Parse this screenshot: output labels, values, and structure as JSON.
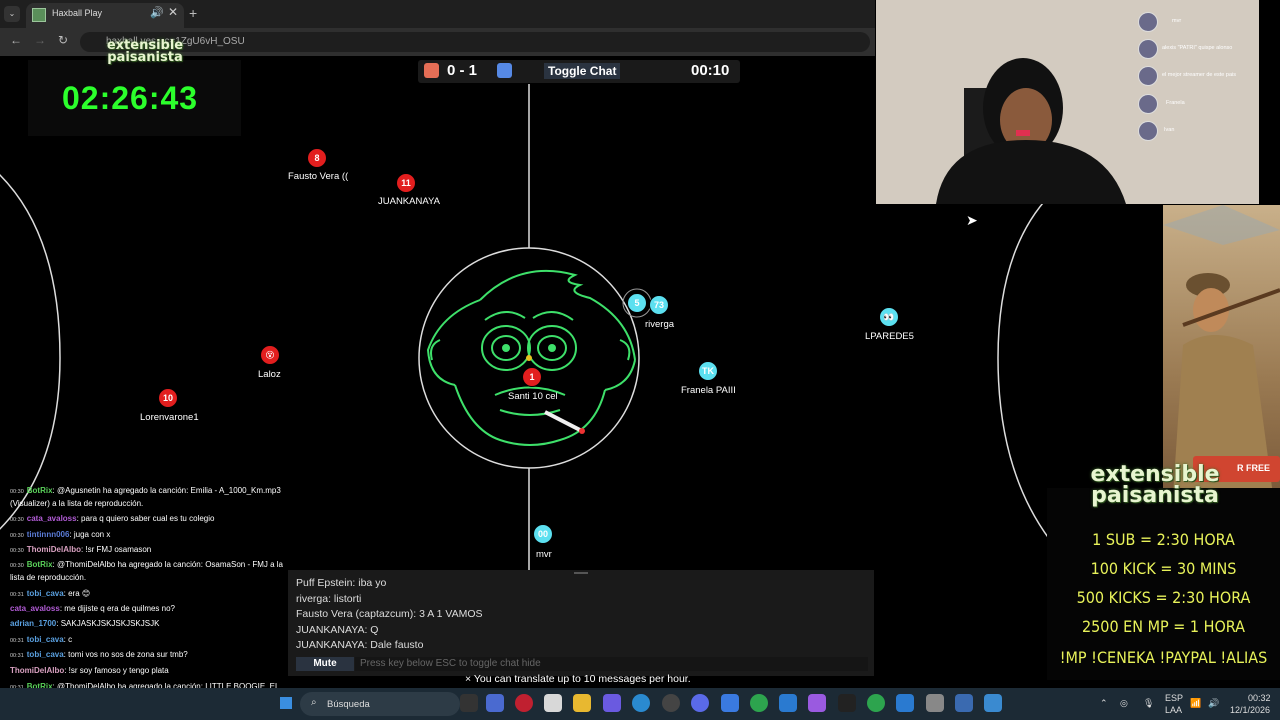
{
  "browser": {
    "tab_title": "Haxball Play",
    "url": "haxball.yes...c=1ZgU6vH_OSU",
    "new_tab": "+",
    "close": "✕",
    "speaker": "🔊",
    "menu": "⌄"
  },
  "stream_overlay": {
    "logo_line1": "extensible",
    "logo_line2": "paisanista",
    "timer": "02:26:43"
  },
  "game": {
    "score": "0 - 1",
    "toggle_chat": "Toggle Chat",
    "time": "00:10",
    "players": [
      {
        "team": "red",
        "number": "8",
        "name": "Fausto Vera (("
      },
      {
        "team": "red",
        "number": "11",
        "name": "JUANKANAYA"
      },
      {
        "team": "red",
        "number": "😵",
        "name": "Laloz"
      },
      {
        "team": "red",
        "number": "10",
        "name": "Lorenvarone1"
      },
      {
        "team": "red",
        "number": "1",
        "name": "Santi 10 cel"
      },
      {
        "team": "blue",
        "number": "5",
        "name": ""
      },
      {
        "team": "blue",
        "number": "73",
        "name": "riverga"
      },
      {
        "team": "blue",
        "number": "TK",
        "name": "Franela PAIII"
      },
      {
        "team": "blue",
        "number": "👀",
        "name": "LPAREDE5"
      },
      {
        "team": "blue",
        "number": "00",
        "name": "mvr"
      }
    ]
  },
  "webcam": {
    "viewers": [
      "mvr",
      "alexis \"PATRI\" quispe alonso",
      "el mejor streamer de este pais",
      "Franela",
      "Ivan"
    ]
  },
  "side_panel": {
    "rfree": "R FREE",
    "logo_line1": "extensible",
    "logo_line2": "paisanista",
    "lines": [
      "1 SUB = 2:30 HORA",
      "100 KICK = 30 MINS",
      "500 KICKS = 2:30 HORA",
      "2500 EN MP = 1 HORA",
      "!MP !CENEKA !PAYPAL !ALIAS"
    ]
  },
  "twitch_chat": [
    {
      "time": "00:30",
      "user": "BotRix",
      "color": "#5ad15a",
      "text": ": @Agusnetin ha agregado la canción: Emilia - A_1000_Km.mp3"
    },
    {
      "time": "",
      "user": "",
      "color": "#ffffff",
      "text": "(Visualizer) a la lista de reproducción."
    },
    {
      "time": "00:30",
      "user": "cata_avaloss",
      "color": "#b25cd6",
      "text": ": para q quiero saber cual es tu colegio"
    },
    {
      "time": "00:30",
      "user": "tintinnn006",
      "color": "#5a7bd6",
      "text": ": juga con x"
    },
    {
      "time": "00:30",
      "user": "ThomiDelAlbo",
      "color": "#d8a0c0",
      "text": ": !sr FMJ osamason"
    },
    {
      "time": "00:30",
      "user": "BotRix",
      "color": "#5ad15a",
      "text": ": @ThomiDelAlbo ha agregado la canción: OsamaSon - FMJ a la"
    },
    {
      "time": "",
      "user": "",
      "color": "#ffffff",
      "text": "lista de reproducción."
    },
    {
      "time": "00:31",
      "user": "tobi_cava",
      "color": "#5aa0e0",
      "text": ": era 😊"
    },
    {
      "time": "",
      "user": "cata_avaloss",
      "color": "#b25cd6",
      "text": ": me dijiste q era de quilmes no?"
    },
    {
      "time": "",
      "user": "adrian_1700",
      "color": "#5aa0e0",
      "text": ": SAKJASKJSKJSKJSKJSJK"
    },
    {
      "time": "00:31",
      "user": "tobi_cava",
      "color": "#5aa0e0",
      "text": ": c"
    },
    {
      "time": "00:31",
      "user": "tobi_cava",
      "color": "#5aa0e0",
      "text": ": tomi vos no sos de zona sur tmb?"
    },
    {
      "time": "",
      "user": "ThomiDelAlbo",
      "color": "#d8a0c0",
      "text": ": !sr soy famoso y tengo plata"
    },
    {
      "time": "00:31",
      "user": "BotRix",
      "color": "#5ad15a",
      "text": ": @ThomiDelAlbo ha agregado la canción: LITTLE BOOGIE, EL"
    },
    {
      "time": "",
      "user": "",
      "color": "#ffffff",
      "text": "DOCTOR & RUSHERKING - SOY FAMOSO Y TENGO PLATA (VIDEOCLIP OFICIAL) a la"
    },
    {
      "time": "",
      "user": "",
      "color": "#ffffff",
      "text": "lista de reproducción."
    }
  ],
  "hax_chat": {
    "messages": [
      "Puff Epstein: iba yo",
      "riverga: listorti",
      "Fausto Vera (captazcum): 3 A 1 VAMOS",
      "JUANKANAYA: Q",
      "JUANKANAYA: Dale fausto"
    ],
    "mute": "Mute",
    "input_placeholder": "Press key below ESC to toggle chat hide",
    "translate": "× You can translate up to 10 messages per hour."
  },
  "taskbar": {
    "search": "Búsqueda",
    "lang1": "ESP",
    "lang2": "LAA",
    "time": "00:32",
    "date": "12/1/2026"
  }
}
